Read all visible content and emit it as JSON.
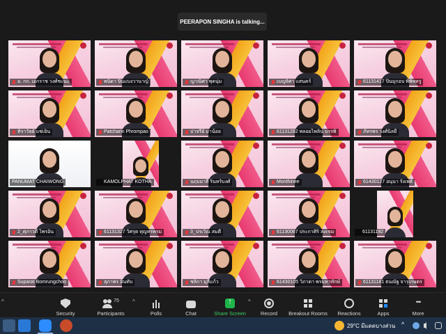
{
  "banner": {
    "speaking_text": "PEERAPON SINGHA is talking..."
  },
  "tiles": [
    {
      "name": "อ. กก. เอกราช วงศ์ชะนะ",
      "muted": true,
      "variant": "bg"
    },
    {
      "name": "พนิดา ปิ่นแบงวานาญ์",
      "muted": true,
      "variant": "bg"
    },
    {
      "name": "ญาณิศา พุดนุ่ม",
      "muted": true,
      "variant": "bg"
    },
    {
      "name": "เบญจิศา แสนคร์",
      "muted": true,
      "variant": "bg"
    },
    {
      "name": "61131417 ปิ่นมุกอบ พิพิพหรู",
      "muted": true,
      "variant": "bg"
    },
    {
      "name": "ทิราวัลย์ แซ่เย็น",
      "muted": true,
      "variant": "bg"
    },
    {
      "name": "Patcharin Phrompao",
      "muted": true,
      "variant": "bg"
    },
    {
      "name": "ปาจรีย์ มาน้อย",
      "muted": true,
      "variant": "bg"
    },
    {
      "name": "61131282 พลอยไพลิน บรรพิ",
      "muted": true,
      "variant": "bg"
    },
    {
      "name": "ภัทรพร วงศ์นิลยื่",
      "muted": true,
      "variant": "bg"
    },
    {
      "name": "PANUMAT CHAIWONG",
      "muted": false,
      "variant": "plain"
    },
    {
      "name": "KAMOLPHAT KOTHA",
      "muted": true,
      "variant": "small"
    },
    {
      "name": "นฤบมาลี รินทร์บงศ์",
      "muted": true,
      "variant": "bg"
    },
    {
      "name": "Monthinee",
      "muted": true,
      "variant": "bg"
    },
    {
      "name": "61430127 อนุนา รังเพธิ",
      "muted": true,
      "variant": "bg"
    },
    {
      "name": "2_ศุภาวดี ไพรอิ่น",
      "muted": true,
      "variant": "bg"
    },
    {
      "name": "61131327 วิศรุต ทุญทรพรม",
      "muted": true,
      "variant": "bg"
    },
    {
      "name": "3_ปรเวิณ สมดี",
      "muted": true,
      "variant": "bg"
    },
    {
      "name": "61130067 ประกาศิริ ลงเขม",
      "muted": true,
      "variant": "bg"
    },
    {
      "name": "61131192",
      "muted": true,
      "variant": "small"
    },
    {
      "name": "Suparat Bomrungchoo",
      "muted": true,
      "variant": "bg"
    },
    {
      "name": "สุภาพร อินทับ",
      "muted": true,
      "variant": "bg"
    },
    {
      "name": "ชลิกา มุลีแก้ว",
      "muted": true,
      "variant": "bg"
    },
    {
      "name": "61430105 วิภาดา พรมหาทักษ์",
      "muted": true,
      "variant": "bg"
    },
    {
      "name": "61131181 ธนณัฐ จารุเกษตร",
      "muted": true,
      "variant": "bg"
    }
  ],
  "toolbar": {
    "security": "Security",
    "participants": "Participants",
    "participants_count": "75",
    "polls": "Polls",
    "chat": "Chat",
    "share_screen": "Share Screen",
    "record": "Record",
    "breakout_rooms": "Breakout Rooms",
    "reactions": "Reactions",
    "apps": "Apps",
    "more": "More",
    "caret": "^"
  },
  "taskbar": {
    "temperature": "29°C",
    "weather_text": "มีแดดบางส่วน",
    "tray_caret": "^"
  },
  "colors": {
    "share_green": "#1fb54a",
    "muted_red": "#e5383b",
    "taskbar": "#1e3046"
  }
}
